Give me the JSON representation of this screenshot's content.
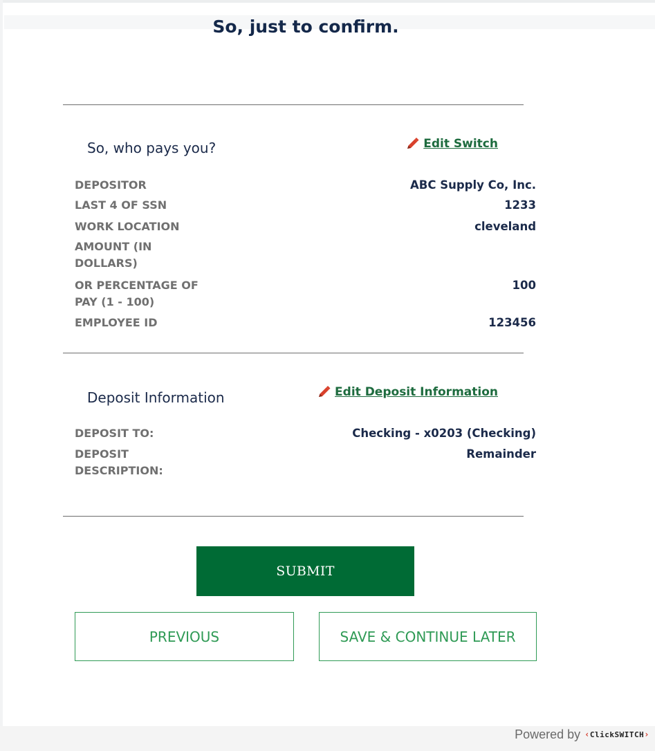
{
  "page": {
    "title": "So, just to confirm."
  },
  "employer_section": {
    "title": "So, who pays you?",
    "edit_label": "Edit Switch",
    "rows": [
      {
        "label": "DEPOSITOR",
        "value": "ABC Supply Co, Inc."
      },
      {
        "label": "LAST 4 OF SSN",
        "value": "1233"
      },
      {
        "label": "WORK LOCATION",
        "value": "cleveland"
      },
      {
        "label": "AMOUNT (IN DOLLARS)",
        "value": ""
      },
      {
        "label": "OR PERCENTAGE OF PAY (1 - 100)",
        "value": "100"
      },
      {
        "label": "EMPLOYEE ID",
        "value": "123456"
      }
    ]
  },
  "deposit_section": {
    "title": "Deposit Information",
    "edit_label": "Edit Deposit Information",
    "rows": [
      {
        "label": "DEPOSIT TO:",
        "value": "Checking - x0203 (Checking)"
      },
      {
        "label": "DEPOSIT DESCRIPTION:",
        "value": "Remainder"
      }
    ]
  },
  "actions": {
    "submit_label": "SUBMIT",
    "previous_label": "PREVIOUS",
    "save_label": "SAVE & CONTINUE LATER"
  },
  "footer": {
    "powered_by": "Powered by",
    "brand": "ClickSWITCH"
  },
  "colors": {
    "primary_green": "#006b35",
    "outline_green": "#2f9a55",
    "link_green": "#1d6b3e",
    "navy": "#1b2a4a"
  },
  "icons": {
    "edit": "pencil-icon"
  }
}
